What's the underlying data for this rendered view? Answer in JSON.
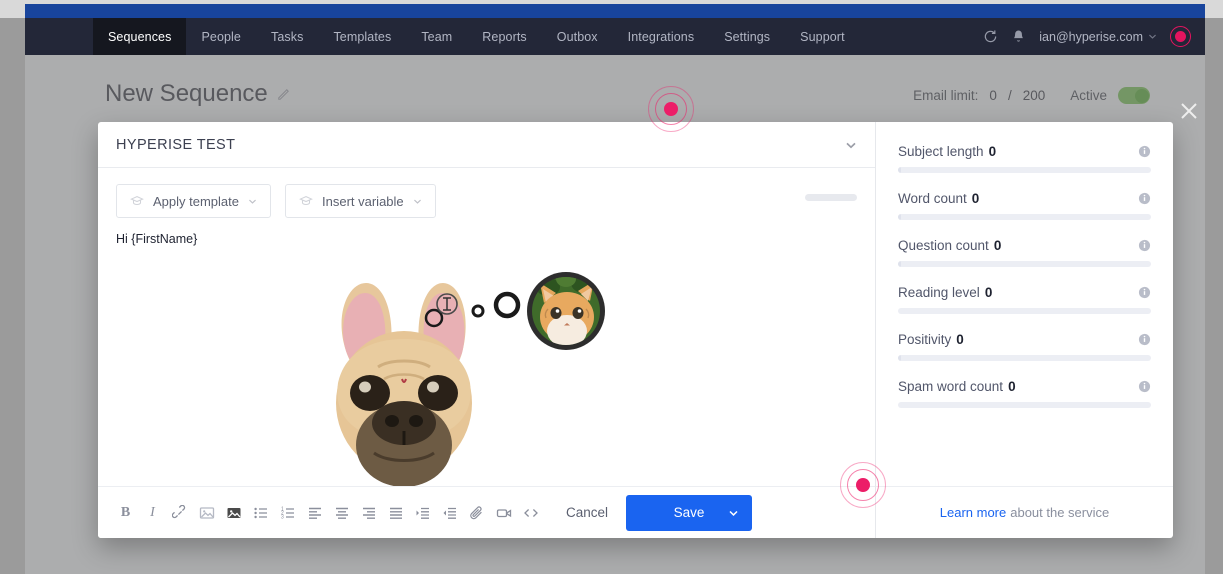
{
  "browser": {
    "strip_color": "#18449c"
  },
  "navbar": {
    "bg": "#232738",
    "items": [
      {
        "label": "Sequences",
        "active": true
      },
      {
        "label": "People",
        "active": false
      },
      {
        "label": "Tasks",
        "active": false
      },
      {
        "label": "Templates",
        "active": false
      },
      {
        "label": "Team",
        "active": false
      },
      {
        "label": "Reports",
        "active": false
      },
      {
        "label": "Outbox",
        "active": false
      },
      {
        "label": "Integrations",
        "active": false
      },
      {
        "label": "Settings",
        "active": false
      },
      {
        "label": "Support",
        "active": false
      }
    ],
    "refresh_icon": "refresh-icon",
    "bell_icon": "bell-icon",
    "user_email": "ian@hyperise.com",
    "user_chevron_icon": "chevron-down-icon",
    "avatar_icon": "avatar-icon",
    "avatar_color": "#e4145f"
  },
  "page": {
    "title": "New Sequence",
    "edit_icon": "pencil-icon",
    "email_limit_label": "Email limit:",
    "email_limit_used": "0",
    "email_limit_sep": "/",
    "email_limit_total": "200",
    "status_label": "Active",
    "status_on": true,
    "status_color": "#6fbf4a",
    "close_icon": "close-icon"
  },
  "modal": {
    "title": "HYPERISE TEST",
    "collapse_icon": "chevron-down-icon",
    "toolbar": {
      "apply_template_label": "Apply template",
      "apply_template_icon": "graduation-cap-icon",
      "insert_variable_label": "Insert variable",
      "insert_variable_icon": "graduation-cap-icon",
      "chevron_icon": "chevron-down-icon"
    },
    "body": {
      "greeting": "Hi {FirstName}",
      "image_alt": "french-bulldog-thinking-of-cat"
    },
    "format_icons": [
      {
        "name": "bold-icon",
        "glyph": "B"
      },
      {
        "name": "italic-icon",
        "glyph": "I"
      },
      {
        "name": "link-icon",
        "glyph": "link"
      },
      {
        "name": "image-icon",
        "glyph": "image"
      },
      {
        "name": "personalized-image-icon",
        "glyph": "image-filled"
      },
      {
        "name": "bullet-list-icon",
        "glyph": "ul"
      },
      {
        "name": "numbered-list-icon",
        "glyph": "ol"
      },
      {
        "name": "align-left-icon",
        "glyph": "align-left"
      },
      {
        "name": "align-center-icon",
        "glyph": "align-center"
      },
      {
        "name": "align-right-icon",
        "glyph": "align-right"
      },
      {
        "name": "align-justify-icon",
        "glyph": "align-justify"
      },
      {
        "name": "indent-increase-icon",
        "glyph": "indent"
      },
      {
        "name": "indent-decrease-icon",
        "glyph": "outdent"
      },
      {
        "name": "attachment-icon",
        "glyph": "paperclip"
      },
      {
        "name": "video-icon",
        "glyph": "video"
      },
      {
        "name": "source-code-icon",
        "glyph": "code"
      }
    ],
    "cancel_label": "Cancel",
    "save_label": "Save",
    "save_chevron_icon": "chevron-down-icon",
    "save_color": "#1a64f0"
  },
  "panel": {
    "metrics": [
      {
        "label": "Subject length",
        "value": "0",
        "info_icon": "info-icon",
        "progress": 1
      },
      {
        "label": "Word count",
        "value": "0",
        "info_icon": "info-icon",
        "progress": 1
      },
      {
        "label": "Question count",
        "value": "0",
        "info_icon": "info-icon",
        "progress": 1
      },
      {
        "label": "Reading level",
        "value": "0",
        "info_icon": "info-icon",
        "progress": 0
      },
      {
        "label": "Positivity",
        "value": "0",
        "info_icon": "info-icon",
        "progress": 1
      },
      {
        "label": "Spam word count",
        "value": "0",
        "info_icon": "info-icon",
        "progress": 0
      }
    ],
    "footer_link": "Learn more",
    "footer_text": "about the service"
  }
}
